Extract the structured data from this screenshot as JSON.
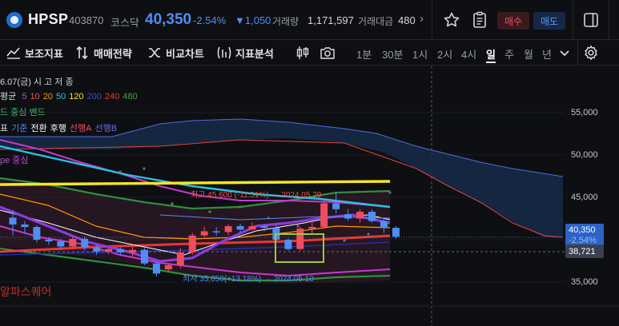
{
  "header": {
    "ticker": "HPSP",
    "code": "403870",
    "market": "코스닥",
    "price": "40,350",
    "change_pct": "-2.54%",
    "change_abs": "▼1,050",
    "volume_label": "거래량",
    "volume_value": "1,171,597",
    "amount_label": "거래대금",
    "amount_value": "480",
    "buy_label": "매수",
    "sell_label": "매도",
    "icons": [
      "star-icon",
      "memo-icon",
      "panel-icon",
      "chevron-right-icon"
    ]
  },
  "toolbar": {
    "items": [
      {
        "label": "보조지표",
        "icon": "indicator-icon"
      },
      {
        "label": "매매전략",
        "icon": "strategy-icon"
      },
      {
        "label": "비교차트",
        "icon": "compare-icon"
      },
      {
        "label": "지표분석",
        "icon": "analysis-icon"
      }
    ],
    "timeframes": [
      "1분",
      "30분",
      "1시",
      "2시",
      "4시",
      "일",
      "주",
      "월",
      "년"
    ],
    "active_timeframe": "일"
  },
  "legend": {
    "date_row": "6.07(금) 시 고 저 종",
    "ma_label": "평균",
    "ma_periods": [
      {
        "label": "5",
        "color": "#c04bd6"
      },
      {
        "label": "10",
        "color": "#ef5350"
      },
      {
        "label": "20",
        "color": "#ff9800"
      },
      {
        "label": "50",
        "color": "#27c3e8"
      },
      {
        "label": "120",
        "color": "#f5e625"
      },
      {
        "label": "200",
        "color": "#3f51b5"
      },
      {
        "label": "240",
        "color": "#e53935"
      },
      {
        "label": "480",
        "color": "#43a047"
      }
    ],
    "bb_row": "드 중심 밴드",
    "ichimoku_parts": [
      {
        "label": "표",
        "color": "#d6d6d6"
      },
      {
        "label": "기준",
        "color": "#4f8ef7"
      },
      {
        "label": "전환",
        "color": "#ffffff"
      },
      {
        "label": "후행",
        "color": "#ffffff"
      },
      {
        "label": "선행A",
        "color": "#ef4d5f"
      },
      {
        "label": "선행B",
        "color": "#5d6df0"
      }
    ],
    "env_row": "pe 중심"
  },
  "annotations": {
    "high": "최고 45,600 (-11.51%) → 2024.05.29",
    "low": "최저 35,650(+13.18%) → 2024.05.10"
  },
  "price_axis": {
    "ticks": [
      "55,000",
      "50,000",
      "45,000",
      "40,000",
      "35,000"
    ],
    "current_price": "40,350",
    "current_sub": "-2.54%",
    "reference_price": "38,721"
  },
  "watermark": "알파스퀘어",
  "colors": {
    "up": "#ef4d5f",
    "down": "#4f8ef7",
    "background": "#0e0f12"
  },
  "chart_data": {
    "type": "candlestick",
    "ylim": [
      33500,
      58500
    ],
    "y_ticks": [
      55000,
      50000,
      45000,
      40000,
      35000
    ],
    "candles": [
      {
        "o": 42600,
        "h": 43500,
        "l": 40500,
        "c": 41800
      },
      {
        "o": 41800,
        "h": 42200,
        "l": 40800,
        "c": 41500
      },
      {
        "o": 41500,
        "h": 41700,
        "l": 39700,
        "c": 40000
      },
      {
        "o": 40000,
        "h": 40300,
        "l": 39400,
        "c": 39800
      },
      {
        "o": 39800,
        "h": 40100,
        "l": 38800,
        "c": 39200
      },
      {
        "o": 39200,
        "h": 40300,
        "l": 38900,
        "c": 40100
      },
      {
        "o": 40100,
        "h": 40400,
        "l": 38700,
        "c": 39100
      },
      {
        "o": 39100,
        "h": 39400,
        "l": 38200,
        "c": 38600
      },
      {
        "o": 38600,
        "h": 39000,
        "l": 38300,
        "c": 38900
      },
      {
        "o": 38900,
        "h": 39100,
        "l": 38100,
        "c": 38500
      },
      {
        "o": 38500,
        "h": 39400,
        "l": 38000,
        "c": 38800
      },
      {
        "o": 38800,
        "h": 39000,
        "l": 37000,
        "c": 37200
      },
      {
        "o": 37200,
        "h": 37400,
        "l": 35650,
        "c": 36000
      },
      {
        "o": 36500,
        "h": 37200,
        "l": 36300,
        "c": 37000
      },
      {
        "o": 37000,
        "h": 39000,
        "l": 36600,
        "c": 38500
      },
      {
        "o": 38500,
        "h": 40800,
        "l": 38200,
        "c": 40500
      },
      {
        "o": 40500,
        "h": 41500,
        "l": 40100,
        "c": 41000
      },
      {
        "o": 41000,
        "h": 41500,
        "l": 40500,
        "c": 40900
      },
      {
        "o": 40900,
        "h": 41800,
        "l": 40500,
        "c": 41600
      },
      {
        "o": 41600,
        "h": 41900,
        "l": 40800,
        "c": 41200
      },
      {
        "o": 41200,
        "h": 42000,
        "l": 41100,
        "c": 41600
      },
      {
        "o": 41600,
        "h": 41800,
        "l": 41000,
        "c": 41400
      },
      {
        "o": 41400,
        "h": 41700,
        "l": 39800,
        "c": 40000
      },
      {
        "o": 40000,
        "h": 40200,
        "l": 38700,
        "c": 38900
      },
      {
        "o": 38900,
        "h": 41500,
        "l": 38700,
        "c": 41300
      },
      {
        "o": 41300,
        "h": 42300,
        "l": 40700,
        "c": 41500
      },
      {
        "o": 41500,
        "h": 44800,
        "l": 41300,
        "c": 44300
      },
      {
        "o": 44300,
        "h": 45600,
        "l": 43100,
        "c": 43600
      },
      {
        "o": 43000,
        "h": 43600,
        "l": 42200,
        "c": 42500
      },
      {
        "o": 42500,
        "h": 43600,
        "l": 42000,
        "c": 43300
      },
      {
        "o": 43300,
        "h": 43600,
        "l": 42000,
        "c": 42200
      },
      {
        "o": 42200,
        "h": 42500,
        "l": 40800,
        "c": 41400
      },
      {
        "o": 41400,
        "h": 41600,
        "l": 40100,
        "c": 40350
      }
    ]
  }
}
